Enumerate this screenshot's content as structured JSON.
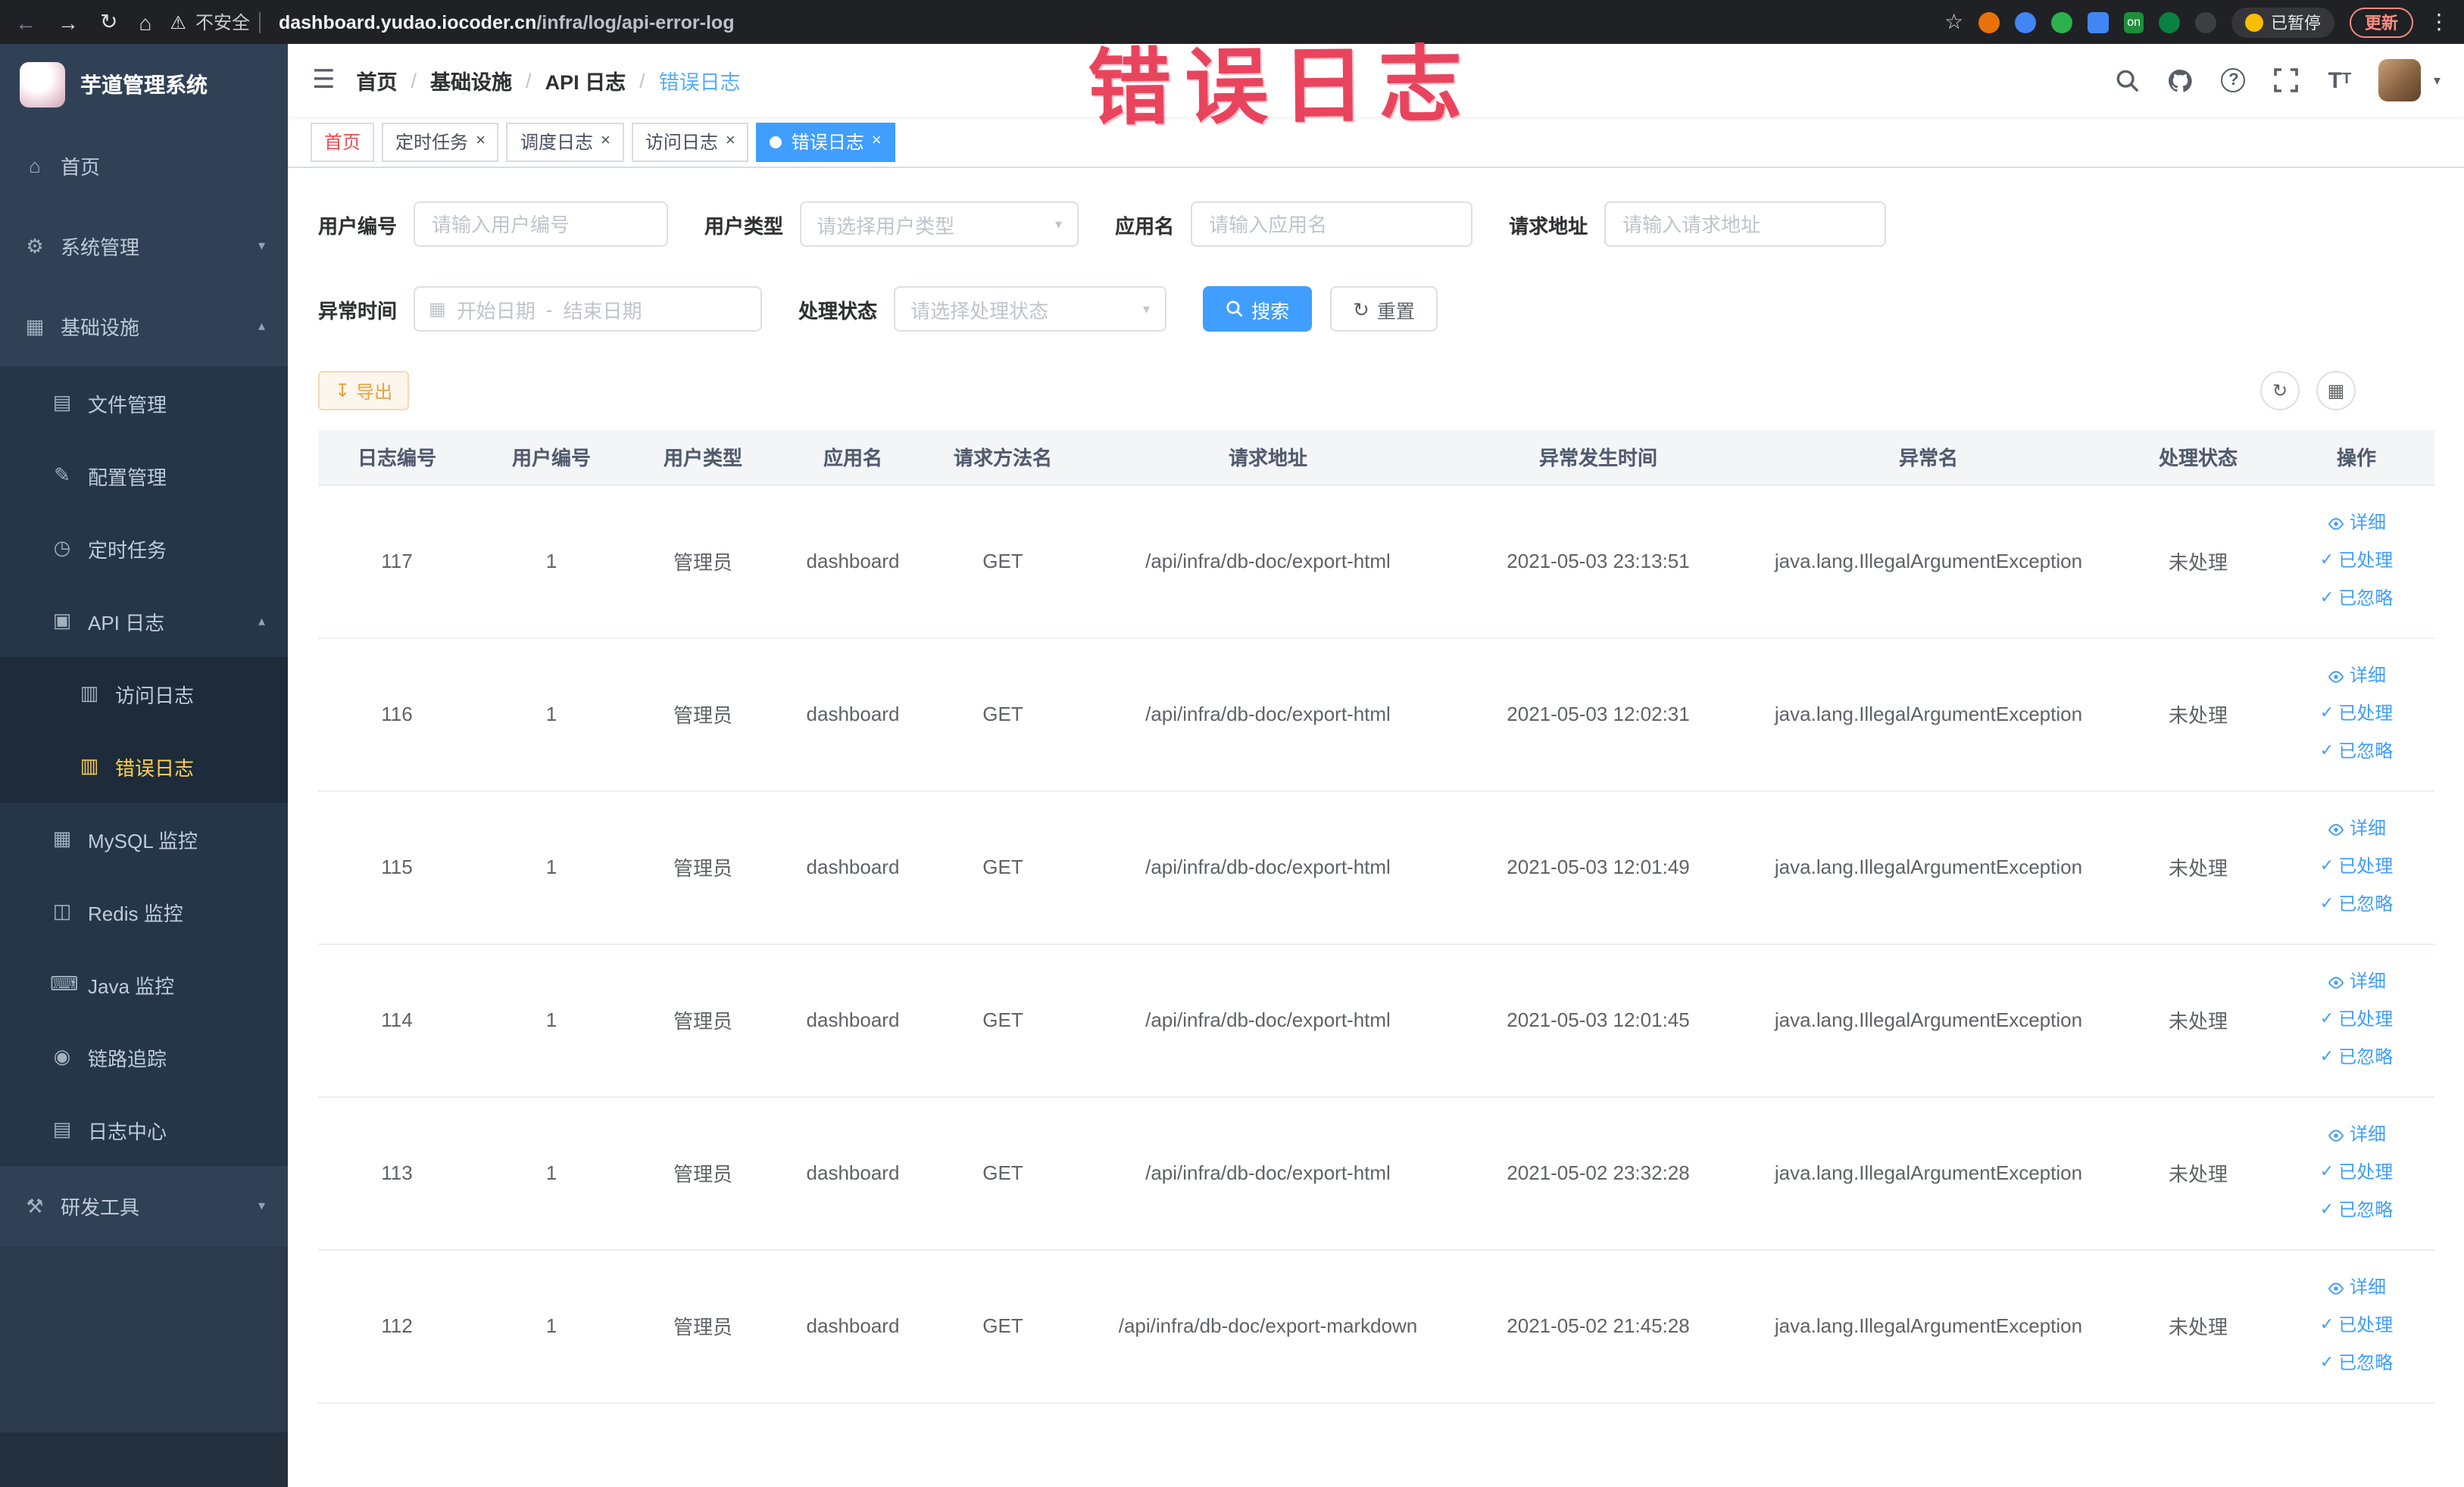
{
  "colors": {
    "accent_blue": "#409eff",
    "sidebar_bg": "#304156",
    "sidebar_active_text": "#ffd04b",
    "warning_orange": "#e6a23c",
    "watermark_red": "#e83a55",
    "link_blue": "#409eff",
    "active_tab_bg": "#409eff"
  },
  "watermark": "错误日志",
  "browser": {
    "security_label": "不安全",
    "url_domain": "dashboard.yudao.iocoder.cn",
    "url_path": "/infra/log/api-error-log",
    "extension_on_badge": "on",
    "paused_badge": "已暂停",
    "update_button": "更新"
  },
  "sidebar": {
    "logo_title": "芋道管理系统",
    "items": [
      {
        "label": "首页",
        "icon": "home-icon",
        "level": 1
      },
      {
        "label": "系统管理",
        "icon": "gear-icon",
        "level": 1,
        "chevron": "down"
      },
      {
        "label": "基础设施",
        "icon": "infrastructure-icon",
        "level": 1,
        "chevron": "up"
      },
      {
        "label": "文件管理",
        "icon": "file-icon",
        "level": 2
      },
      {
        "label": "配置管理",
        "icon": "config-icon",
        "level": 2
      },
      {
        "label": "定时任务",
        "icon": "schedule-icon",
        "level": 2
      },
      {
        "label": "API 日志",
        "icon": "api-log-icon",
        "level": 2,
        "chevron": "up"
      },
      {
        "label": "访问日志",
        "icon": "log-icon",
        "level": 3
      },
      {
        "label": "错误日志",
        "icon": "log-icon",
        "level": 3,
        "active": true
      },
      {
        "label": "MySQL 监控",
        "icon": "mysql-icon",
        "level": 2
      },
      {
        "label": "Redis 监控",
        "icon": "redis-icon",
        "level": 2
      },
      {
        "label": "Java 监控",
        "icon": "java-icon",
        "level": 2
      },
      {
        "label": "链路追踪",
        "icon": "trace-icon",
        "level": 2
      },
      {
        "label": "日志中心",
        "icon": "log-center-icon",
        "level": 2
      },
      {
        "label": "研发工具",
        "icon": "devtools-icon",
        "level": 1,
        "chevron": "down"
      }
    ]
  },
  "header": {
    "breadcrumb": [
      "首页",
      "基础设施",
      "API 日志",
      "错误日志"
    ],
    "breadcrumb_separator": "/"
  },
  "tabs": [
    {
      "label": "首页",
      "closable": false,
      "active": false
    },
    {
      "label": "定时任务",
      "closable": true,
      "active": false
    },
    {
      "label": "调度日志",
      "closable": true,
      "active": false
    },
    {
      "label": "访问日志",
      "closable": true,
      "active": false
    },
    {
      "label": "错误日志",
      "closable": true,
      "active": true
    }
  ],
  "filters": {
    "user_id": {
      "label": "用户编号",
      "placeholder": "请输入用户编号",
      "value": ""
    },
    "user_type": {
      "label": "用户类型",
      "placeholder": "请选择用户类型"
    },
    "app_name": {
      "label": "应用名",
      "placeholder": "请输入应用名",
      "value": ""
    },
    "request_url": {
      "label": "请求地址",
      "placeholder": "请输入请求地址",
      "value": ""
    },
    "exception_time": {
      "label": "异常时间",
      "start_placeholder": "开始日期",
      "end_placeholder": "结束日期",
      "separator": "-"
    },
    "process_status": {
      "label": "处理状态",
      "placeholder": "请选择处理状态"
    },
    "search_label": "搜索",
    "reset_label": "重置"
  },
  "toolbar": {
    "export_label": "导出"
  },
  "table": {
    "columns": [
      "日志编号",
      "用户编号",
      "用户类型",
      "应用名",
      "请求方法名",
      "请求地址",
      "异常发生时间",
      "异常名",
      "处理状态",
      "操作"
    ],
    "actions": {
      "detail": "详细",
      "processed": "已处理",
      "ignored": "已忽略"
    },
    "rows": [
      {
        "id": "117",
        "user_id": "1",
        "user_type": "管理员",
        "app": "dashboard",
        "method": "GET",
        "url": "/api/infra/db-doc/export-html",
        "time": "2021-05-03 23:13:51",
        "exception": "java.lang.IllegalArgumentException",
        "status": "未处理"
      },
      {
        "id": "116",
        "user_id": "1",
        "user_type": "管理员",
        "app": "dashboard",
        "method": "GET",
        "url": "/api/infra/db-doc/export-html",
        "time": "2021-05-03 12:02:31",
        "exception": "java.lang.IllegalArgumentException",
        "status": "未处理"
      },
      {
        "id": "115",
        "user_id": "1",
        "user_type": "管理员",
        "app": "dashboard",
        "method": "GET",
        "url": "/api/infra/db-doc/export-html",
        "time": "2021-05-03 12:01:49",
        "exception": "java.lang.IllegalArgumentException",
        "status": "未处理"
      },
      {
        "id": "114",
        "user_id": "1",
        "user_type": "管理员",
        "app": "dashboard",
        "method": "GET",
        "url": "/api/infra/db-doc/export-html",
        "time": "2021-05-03 12:01:45",
        "exception": "java.lang.IllegalArgumentException",
        "status": "未处理"
      },
      {
        "id": "113",
        "user_id": "1",
        "user_type": "管理员",
        "app": "dashboard",
        "method": "GET",
        "url": "/api/infra/db-doc/export-html",
        "time": "2021-05-02 23:32:28",
        "exception": "java.lang.IllegalArgumentException",
        "status": "未处理"
      },
      {
        "id": "112",
        "user_id": "1",
        "user_type": "管理员",
        "app": "dashboard",
        "method": "GET",
        "url": "/api/infra/db-doc/export-markdown",
        "time": "2021-05-02 21:45:28",
        "exception": "java.lang.IllegalArgumentException",
        "status": "未处理"
      }
    ]
  }
}
